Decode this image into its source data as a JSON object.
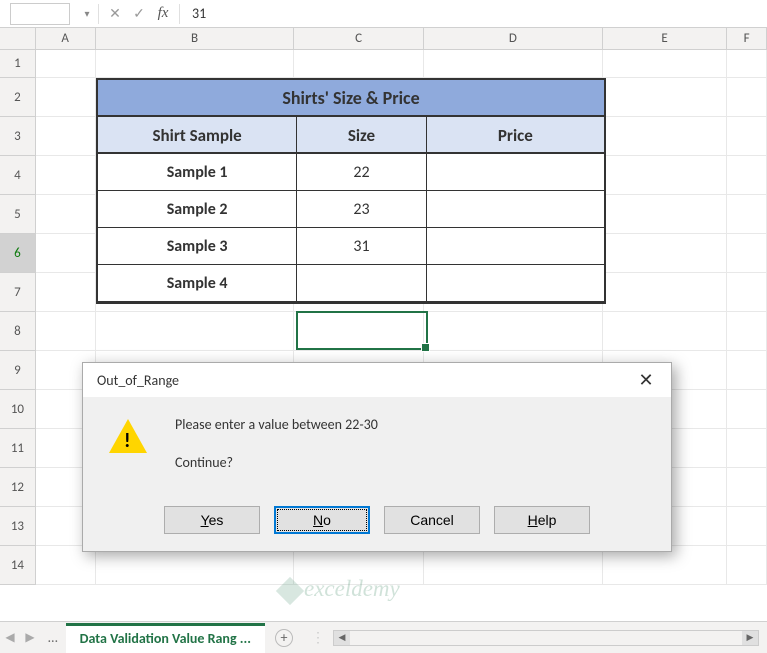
{
  "formula_bar": {
    "fx_label": "fx",
    "value": "31"
  },
  "columns": [
    "A",
    "B",
    "C",
    "D",
    "E",
    "F"
  ],
  "rows": [
    "1",
    "2",
    "3",
    "4",
    "5",
    "6",
    "7",
    "8",
    "9",
    "10",
    "11",
    "12",
    "13",
    "14"
  ],
  "selected_row": "6",
  "table": {
    "title": "Shirts' Size & Price",
    "headers": {
      "c1": "Shirt Sample",
      "c2": "Size",
      "c3": "Price"
    },
    "data": [
      {
        "sample": "Sample 1",
        "size": "22",
        "price": ""
      },
      {
        "sample": "Sample 2",
        "size": "23",
        "price": ""
      },
      {
        "sample": "Sample 3",
        "size": "31",
        "price": ""
      },
      {
        "sample": "Sample 4",
        "size": "",
        "price": ""
      }
    ]
  },
  "dialog": {
    "title": "Out_of_Range",
    "message": "Please enter a value between 22-30",
    "prompt": "Continue?",
    "buttons": {
      "yes": "Yes",
      "no": "No",
      "cancel": "Cancel",
      "help": "Help"
    }
  },
  "sheet": {
    "active_tab": "Data Validation Value Rang",
    "ellipsis": "..."
  },
  "watermark": "exceldemy"
}
